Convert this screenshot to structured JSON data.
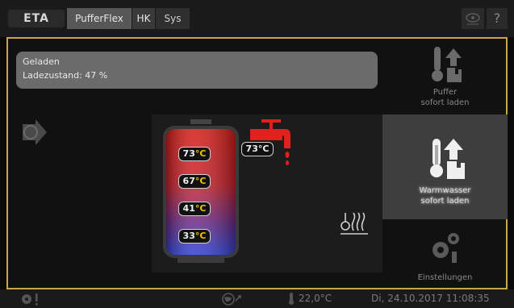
{
  "topbar": {
    "logo": "ETA",
    "tabs": [
      {
        "label": "PufferFlex",
        "active": true
      },
      {
        "label": "HK",
        "active": false
      },
      {
        "label": "Sys",
        "active": false
      }
    ],
    "help_label": "?"
  },
  "status": {
    "line1": "Geladen",
    "line2": "Ladezustand: 47 %"
  },
  "tank": {
    "temps": [
      {
        "value": "73",
        "unit": "°C"
      },
      {
        "value": "67",
        "unit": "°C"
      },
      {
        "value": "41",
        "unit": "°C"
      },
      {
        "value": "33",
        "unit": "°C"
      }
    ],
    "outlet": {
      "value": "73",
      "unit": "°C"
    }
  },
  "side_buttons": {
    "puffer_line1": "Puffer",
    "puffer_line2": "sofort laden",
    "warm_line1": "Warmwasser",
    "warm_line2": "sofort laden",
    "settings": "Einstellungen"
  },
  "bottombar": {
    "outdoor_temp": "22,0°C",
    "datetime": "Di, 24.10.2017 11:08:35"
  },
  "colors": {
    "accent": "#c8a64a",
    "tank_hot": "#e0201a",
    "tank_cold": "#2a3fd6",
    "unit": "#f3c300",
    "tap": "#e0201a"
  }
}
